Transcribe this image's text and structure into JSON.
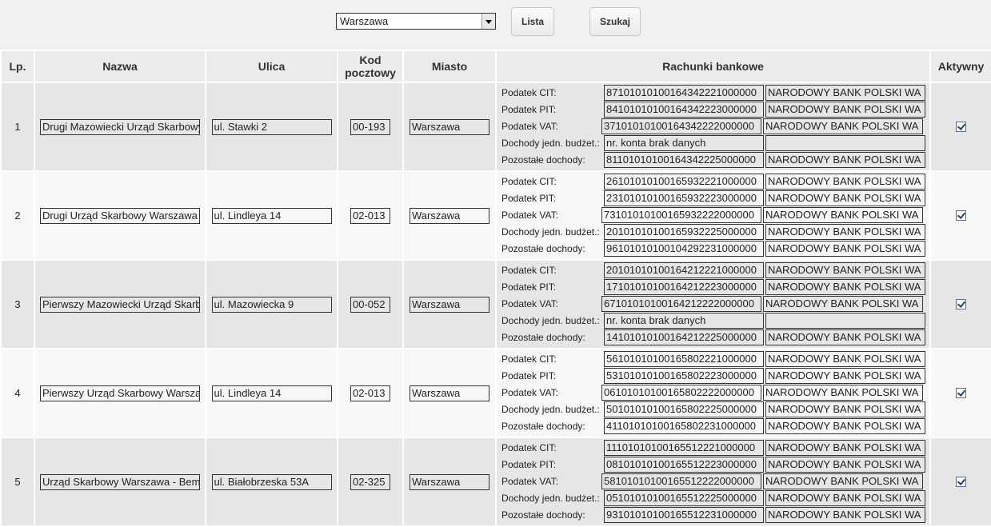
{
  "toolbar": {
    "city_select_value": "Warszawa",
    "lista_label": "Lista",
    "szukaj_label": "Szukaj"
  },
  "headers": {
    "lp": "Lp.",
    "nazwa": "Nazwa",
    "ulica": "Ulica",
    "kod": "Kod pocztowy",
    "miasto": "Miasto",
    "rachunki": "Rachunki bankowe",
    "aktywny": "Aktywny"
  },
  "labels": {
    "cit": "Podatek CIT:",
    "pit": "Podatek PIT:",
    "vat": "Podatek VAT:",
    "budzet": "Dochody jedn. budżet.:",
    "pozostale": "Pozostałe dochody:"
  },
  "rows": [
    {
      "lp": "1",
      "nazwa": "Drugi Mazowiecki Urząd Skarbowy",
      "ulica": "ul. Stawki 2",
      "kod": "00-193",
      "miasto": "Warszawa",
      "aktywny": true,
      "accounts": [
        {
          "num": "87101010100164342221000000",
          "bank": "NARODOWY BANK POLSKI WA"
        },
        {
          "num": "84101010100164342223000000",
          "bank": "NARODOWY BANK POLSKI WA"
        },
        {
          "num": "37101010100164342222000000",
          "bank": "NARODOWY BANK POLSKI WA"
        },
        {
          "num": "nr. konta brak danych",
          "bank": ""
        },
        {
          "num": "81101010100164342225000000",
          "bank": "NARODOWY BANK POLSKI WA"
        }
      ]
    },
    {
      "lp": "2",
      "nazwa": "Drugi Urząd Skarbowy Warszawa",
      "ulica": "ul. Lindleya 14",
      "kod": "02-013",
      "miasto": "Warszawa",
      "aktywny": true,
      "accounts": [
        {
          "num": "26101010100165932221000000",
          "bank": "NARODOWY BANK POLSKI WA"
        },
        {
          "num": "23101010100165932223000000",
          "bank": "NARODOWY BANK POLSKI WA"
        },
        {
          "num": "73101010100165932222000000",
          "bank": "NARODOWY BANK POLSKI WA"
        },
        {
          "num": "20101010100165932225000000",
          "bank": "NARODOWY BANK POLSKI WA"
        },
        {
          "num": "96101010100104292231000000",
          "bank": "NARODOWY BANK POLSKI WA"
        }
      ]
    },
    {
      "lp": "3",
      "nazwa": "Pierwszy Mazowiecki Urząd Skarbowy",
      "ulica": "ul. Mazowiecka 9",
      "kod": "00-052",
      "miasto": "Warszawa",
      "aktywny": true,
      "accounts": [
        {
          "num": "20101010100164212221000000",
          "bank": "NARODOWY BANK POLSKI WA"
        },
        {
          "num": "17101010100164212223000000",
          "bank": "NARODOWY BANK POLSKI WA"
        },
        {
          "num": "67101010100164212222000000",
          "bank": "NARODOWY BANK POLSKI WA"
        },
        {
          "num": "nr. konta brak danych",
          "bank": ""
        },
        {
          "num": "14101010100164212225000000",
          "bank": "NARODOWY BANK POLSKI WA"
        }
      ]
    },
    {
      "lp": "4",
      "nazwa": "Pierwszy Urząd Skarbowy Warszawa",
      "ulica": "ul. Lindleya 14",
      "kod": "02-013",
      "miasto": "Warszawa",
      "aktywny": true,
      "accounts": [
        {
          "num": "56101010100165802221000000",
          "bank": "NARODOWY BANK POLSKI WA"
        },
        {
          "num": "53101010100165802223000000",
          "bank": "NARODOWY BANK POLSKI WA"
        },
        {
          "num": "06101010100165802222000000",
          "bank": "NARODOWY BANK POLSKI WA"
        },
        {
          "num": "50101010100165802225000000",
          "bank": "NARODOWY BANK POLSKI WA"
        },
        {
          "num": "41101010100165802231000000",
          "bank": "NARODOWY BANK POLSKI WA"
        }
      ]
    },
    {
      "lp": "5",
      "nazwa": "Urząd Skarbowy Warszawa - Bemowo",
      "ulica": "ul. Białobrzeska 53A",
      "kod": "02-325",
      "miasto": "Warszawa",
      "aktywny": true,
      "accounts": [
        {
          "num": "11101010100165512221000000",
          "bank": "NARODOWY BANK POLSKI WA"
        },
        {
          "num": "08101010100165512223000000",
          "bank": "NARODOWY BANK POLSKI WA"
        },
        {
          "num": "58101010100165512222000000",
          "bank": "NARODOWY BANK POLSKI WA"
        },
        {
          "num": "05101010100165512225000000",
          "bank": "NARODOWY BANK POLSKI WA"
        },
        {
          "num": "93101010100165512231000000",
          "bank": "NARODOWY BANK POLSKI WA"
        }
      ]
    }
  ]
}
